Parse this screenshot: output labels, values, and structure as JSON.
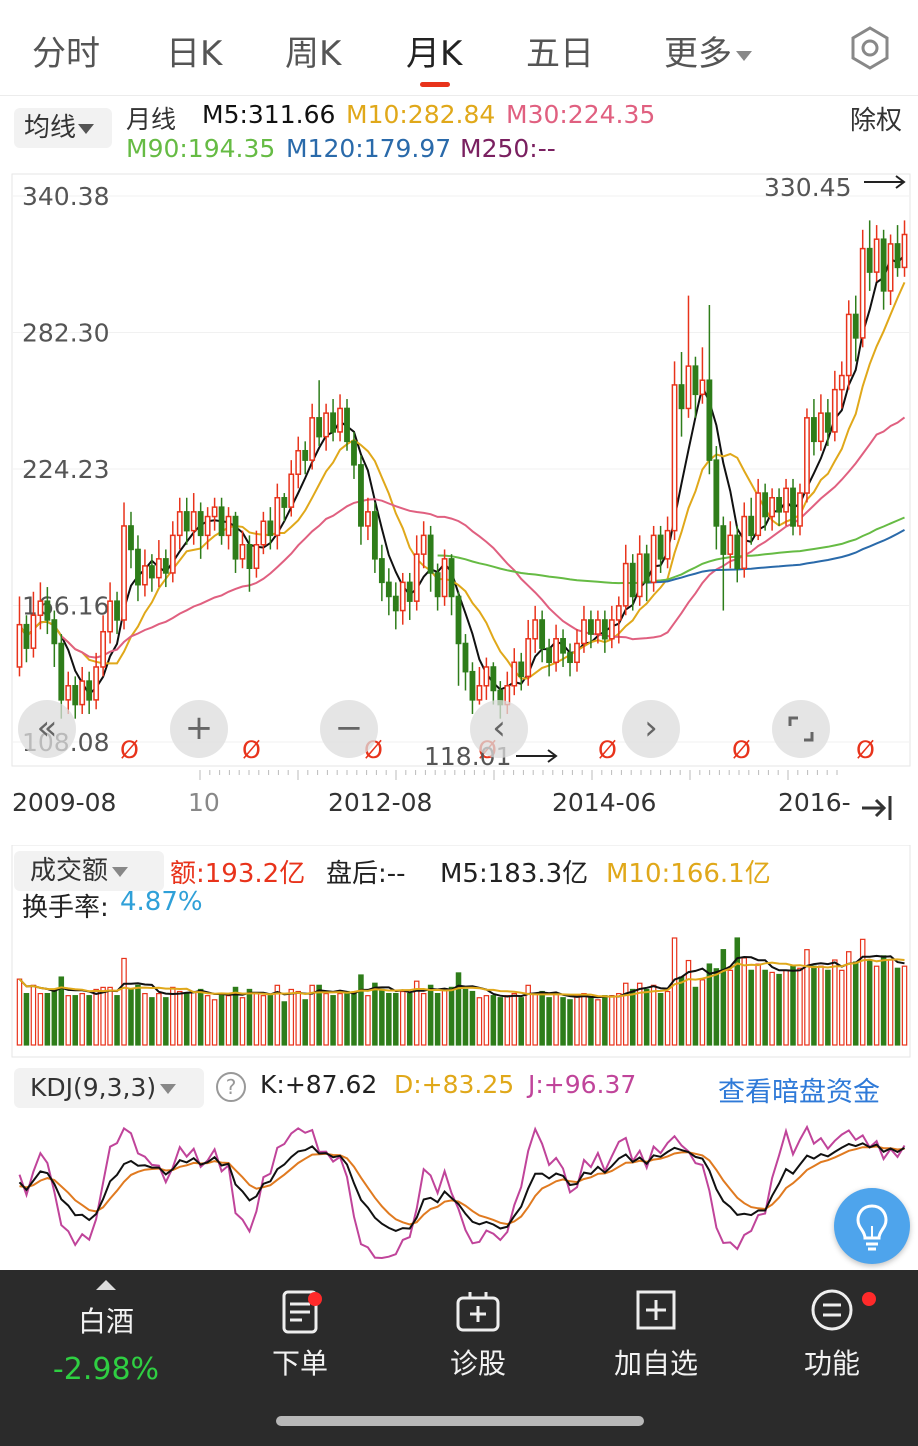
{
  "tabs": [
    {
      "label": "分时"
    },
    {
      "label": "日K"
    },
    {
      "label": "周K"
    },
    {
      "label": "月K"
    },
    {
      "label": "五日"
    },
    {
      "label": "更多"
    }
  ],
  "active_tab": "月K",
  "ma_bar": {
    "select_label": "均线",
    "period_label": "月线",
    "m5": "M5:311.66",
    "m10": "M10:282.84",
    "m30": "M30:224.35",
    "m90": "M90:194.35",
    "m120": "M120:179.97",
    "m250": "M250:--",
    "adjust_label": "除权"
  },
  "colors": {
    "up": "#e8331b",
    "down": "#2e7d1a",
    "m5": "#111111",
    "m10": "#e0a81a",
    "m30": "#e06080",
    "m90": "#66bb44",
    "m120": "#2a6aaa",
    "m250": "#7a2060",
    "accent_link": "#2f7ad8"
  },
  "main_chart": {
    "price_levels": [
      "340.38",
      "282.30",
      "224.23",
      "166.16",
      "108.08"
    ],
    "high_marker": "330.45",
    "low_marker": "118.01",
    "dividend_mark": "Ø",
    "dates": [
      "2009-08",
      "10",
      "2012-08",
      "2014-06",
      "2016-"
    ],
    "controls": {
      "zoom_in": "+",
      "zoom_out": "−",
      "prev": "‹",
      "next": "›",
      "rewind": "«"
    }
  },
  "chart_data": {
    "type": "candlestick",
    "ylim": [
      108.08,
      340.38
    ],
    "y_ticks": [
      340.38,
      282.3,
      224.23,
      166.16,
      108.08
    ],
    "x_tick_labels": [
      "2009-08",
      "10",
      "2012-08",
      "2014-06",
      "2016-"
    ],
    "series": [
      {
        "name": "月K",
        "values": [
          {
            "o": 140,
            "c": 158,
            "h": 170,
            "l": 136
          },
          {
            "o": 158,
            "c": 148,
            "h": 162,
            "l": 142
          },
          {
            "o": 148,
            "c": 162,
            "h": 172,
            "l": 144
          },
          {
            "o": 162,
            "c": 168,
            "h": 176,
            "l": 156
          },
          {
            "o": 168,
            "c": 160,
            "h": 174,
            "l": 154
          },
          {
            "o": 160,
            "c": 150,
            "h": 164,
            "l": 140
          },
          {
            "o": 150,
            "c": 126,
            "h": 154,
            "l": 118
          },
          {
            "o": 126,
            "c": 132,
            "h": 138,
            "l": 120
          },
          {
            "o": 132,
            "c": 124,
            "h": 136,
            "l": 118
          },
          {
            "o": 124,
            "c": 134,
            "h": 140,
            "l": 120
          },
          {
            "o": 134,
            "c": 126,
            "h": 138,
            "l": 120
          },
          {
            "o": 126,
            "c": 140,
            "h": 146,
            "l": 122
          },
          {
            "o": 140,
            "c": 155,
            "h": 162,
            "l": 136
          },
          {
            "o": 155,
            "c": 168,
            "h": 176,
            "l": 150
          },
          {
            "o": 168,
            "c": 160,
            "h": 172,
            "l": 154
          },
          {
            "o": 160,
            "c": 200,
            "h": 210,
            "l": 156
          },
          {
            "o": 200,
            "c": 190,
            "h": 206,
            "l": 182
          },
          {
            "o": 190,
            "c": 175,
            "h": 196,
            "l": 168
          },
          {
            "o": 175,
            "c": 183,
            "h": 190,
            "l": 170
          },
          {
            "o": 183,
            "c": 178,
            "h": 188,
            "l": 172
          },
          {
            "o": 178,
            "c": 186,
            "h": 194,
            "l": 174
          },
          {
            "o": 186,
            "c": 180,
            "h": 190,
            "l": 174
          },
          {
            "o": 180,
            "c": 196,
            "h": 202,
            "l": 176
          },
          {
            "o": 196,
            "c": 206,
            "h": 212,
            "l": 190
          },
          {
            "o": 206,
            "c": 198,
            "h": 212,
            "l": 192
          },
          {
            "o": 198,
            "c": 206,
            "h": 214,
            "l": 192
          },
          {
            "o": 206,
            "c": 196,
            "h": 210,
            "l": 186
          },
          {
            "o": 196,
            "c": 204,
            "h": 208,
            "l": 190
          },
          {
            "o": 204,
            "c": 208,
            "h": 212,
            "l": 198
          },
          {
            "o": 208,
            "c": 196,
            "h": 212,
            "l": 192
          },
          {
            "o": 196,
            "c": 204,
            "h": 208,
            "l": 190
          },
          {
            "o": 204,
            "c": 186,
            "h": 206,
            "l": 180
          },
          {
            "o": 186,
            "c": 192,
            "h": 198,
            "l": 182
          },
          {
            "o": 192,
            "c": 182,
            "h": 196,
            "l": 172
          },
          {
            "o": 182,
            "c": 192,
            "h": 198,
            "l": 178
          },
          {
            "o": 192,
            "c": 202,
            "h": 206,
            "l": 188
          },
          {
            "o": 202,
            "c": 196,
            "h": 208,
            "l": 190
          },
          {
            "o": 196,
            "c": 212,
            "h": 218,
            "l": 190
          },
          {
            "o": 212,
            "c": 208,
            "h": 214,
            "l": 202
          },
          {
            "o": 208,
            "c": 222,
            "h": 228,
            "l": 204
          },
          {
            "o": 222,
            "c": 232,
            "h": 238,
            "l": 216
          },
          {
            "o": 232,
            "c": 228,
            "h": 236,
            "l": 222
          },
          {
            "o": 228,
            "c": 246,
            "h": 252,
            "l": 224
          },
          {
            "o": 246,
            "c": 238,
            "h": 262,
            "l": 234
          },
          {
            "o": 238,
            "c": 248,
            "h": 252,
            "l": 232
          },
          {
            "o": 248,
            "c": 240,
            "h": 254,
            "l": 236
          },
          {
            "o": 240,
            "c": 250,
            "h": 256,
            "l": 236
          },
          {
            "o": 250,
            "c": 236,
            "h": 254,
            "l": 232
          },
          {
            "o": 236,
            "c": 226,
            "h": 240,
            "l": 220
          },
          {
            "o": 226,
            "c": 200,
            "h": 230,
            "l": 192
          },
          {
            "o": 200,
            "c": 206,
            "h": 212,
            "l": 194
          },
          {
            "o": 206,
            "c": 186,
            "h": 210,
            "l": 180
          },
          {
            "o": 186,
            "c": 176,
            "h": 192,
            "l": 168
          },
          {
            "o": 176,
            "c": 170,
            "h": 182,
            "l": 162
          },
          {
            "o": 170,
            "c": 164,
            "h": 176,
            "l": 156
          },
          {
            "o": 164,
            "c": 176,
            "h": 180,
            "l": 158
          },
          {
            "o": 176,
            "c": 168,
            "h": 180,
            "l": 160
          },
          {
            "o": 168,
            "c": 188,
            "h": 196,
            "l": 164
          },
          {
            "o": 188,
            "c": 196,
            "h": 202,
            "l": 182
          },
          {
            "o": 196,
            "c": 180,
            "h": 200,
            "l": 172
          },
          {
            "o": 180,
            "c": 170,
            "h": 184,
            "l": 164
          },
          {
            "o": 170,
            "c": 186,
            "h": 190,
            "l": 166
          },
          {
            "o": 186,
            "c": 170,
            "h": 188,
            "l": 162
          },
          {
            "o": 170,
            "c": 150,
            "h": 172,
            "l": 132
          },
          {
            "o": 150,
            "c": 138,
            "h": 154,
            "l": 130
          },
          {
            "o": 138,
            "c": 126,
            "h": 142,
            "l": 120
          },
          {
            "o": 126,
            "c": 132,
            "h": 140,
            "l": 124
          },
          {
            "o": 132,
            "c": 140,
            "h": 144,
            "l": 126
          },
          {
            "o": 140,
            "c": 130,
            "h": 142,
            "l": 124
          },
          {
            "o": 130,
            "c": 124,
            "h": 134,
            "l": 118
          },
          {
            "o": 124,
            "c": 132,
            "h": 138,
            "l": 120
          },
          {
            "o": 132,
            "c": 142,
            "h": 148,
            "l": 128
          },
          {
            "o": 142,
            "c": 136,
            "h": 146,
            "l": 130
          },
          {
            "o": 136,
            "c": 152,
            "h": 160,
            "l": 132
          },
          {
            "o": 152,
            "c": 160,
            "h": 166,
            "l": 146
          },
          {
            "o": 160,
            "c": 148,
            "h": 164,
            "l": 142
          },
          {
            "o": 148,
            "c": 142,
            "h": 152,
            "l": 136
          },
          {
            "o": 142,
            "c": 152,
            "h": 158,
            "l": 138
          },
          {
            "o": 152,
            "c": 146,
            "h": 156,
            "l": 140
          },
          {
            "o": 146,
            "c": 142,
            "h": 150,
            "l": 136
          },
          {
            "o": 142,
            "c": 150,
            "h": 156,
            "l": 138
          },
          {
            "o": 150,
            "c": 160,
            "h": 166,
            "l": 146
          },
          {
            "o": 160,
            "c": 154,
            "h": 164,
            "l": 148
          },
          {
            "o": 154,
            "c": 160,
            "h": 164,
            "l": 150
          },
          {
            "o": 160,
            "c": 152,
            "h": 164,
            "l": 146
          },
          {
            "o": 152,
            "c": 160,
            "h": 166,
            "l": 148
          },
          {
            "o": 160,
            "c": 166,
            "h": 170,
            "l": 150
          },
          {
            "o": 166,
            "c": 184,
            "h": 192,
            "l": 162
          },
          {
            "o": 184,
            "c": 170,
            "h": 188,
            "l": 164
          },
          {
            "o": 170,
            "c": 188,
            "h": 196,
            "l": 166
          },
          {
            "o": 188,
            "c": 176,
            "h": 192,
            "l": 168
          },
          {
            "o": 176,
            "c": 196,
            "h": 200,
            "l": 172
          },
          {
            "o": 196,
            "c": 186,
            "h": 200,
            "l": 180
          },
          {
            "o": 186,
            "c": 198,
            "h": 204,
            "l": 182
          },
          {
            "o": 198,
            "c": 260,
            "h": 270,
            "l": 194
          },
          {
            "o": 260,
            "c": 250,
            "h": 274,
            "l": 238
          },
          {
            "o": 250,
            "c": 268,
            "h": 298,
            "l": 246
          },
          {
            "o": 268,
            "c": 256,
            "h": 272,
            "l": 246
          },
          {
            "o": 256,
            "c": 262,
            "h": 276,
            "l": 252
          },
          {
            "o": 262,
            "c": 228,
            "h": 294,
            "l": 222
          },
          {
            "o": 228,
            "c": 200,
            "h": 234,
            "l": 190
          },
          {
            "o": 200,
            "c": 188,
            "h": 204,
            "l": 164
          },
          {
            "o": 188,
            "c": 196,
            "h": 202,
            "l": 182
          },
          {
            "o": 196,
            "c": 182,
            "h": 200,
            "l": 176
          },
          {
            "o": 182,
            "c": 204,
            "h": 210,
            "l": 178
          },
          {
            "o": 204,
            "c": 196,
            "h": 212,
            "l": 192
          },
          {
            "o": 196,
            "c": 214,
            "h": 220,
            "l": 194
          },
          {
            "o": 214,
            "c": 204,
            "h": 218,
            "l": 198
          },
          {
            "o": 204,
            "c": 212,
            "h": 216,
            "l": 198
          },
          {
            "o": 212,
            "c": 206,
            "h": 216,
            "l": 200
          },
          {
            "o": 206,
            "c": 216,
            "h": 220,
            "l": 200
          },
          {
            "o": 216,
            "c": 200,
            "h": 220,
            "l": 196
          },
          {
            "o": 200,
            "c": 214,
            "h": 218,
            "l": 196
          },
          {
            "o": 214,
            "c": 246,
            "h": 250,
            "l": 210
          },
          {
            "o": 246,
            "c": 236,
            "h": 254,
            "l": 230
          },
          {
            "o": 236,
            "c": 248,
            "h": 256,
            "l": 232
          },
          {
            "o": 248,
            "c": 240,
            "h": 254,
            "l": 234
          },
          {
            "o": 240,
            "c": 258,
            "h": 266,
            "l": 236
          },
          {
            "o": 258,
            "c": 264,
            "h": 270,
            "l": 250
          },
          {
            "o": 264,
            "c": 290,
            "h": 296,
            "l": 258
          },
          {
            "o": 290,
            "c": 280,
            "h": 298,
            "l": 270
          },
          {
            "o": 280,
            "c": 318,
            "h": 326,
            "l": 276
          },
          {
            "o": 318,
            "c": 308,
            "h": 330,
            "l": 300
          },
          {
            "o": 308,
            "c": 322,
            "h": 328,
            "l": 304
          },
          {
            "o": 322,
            "c": 300,
            "h": 326,
            "l": 292
          },
          {
            "o": 300,
            "c": 320,
            "h": 324,
            "l": 294
          },
          {
            "o": 320,
            "c": 310,
            "h": 328,
            "l": 306
          },
          {
            "o": 310,
            "c": 324,
            "h": 330,
            "l": 306
          }
        ]
      },
      {
        "name": "M5"
      },
      {
        "name": "M10"
      },
      {
        "name": "M30"
      },
      {
        "name": "M90"
      },
      {
        "name": "M120"
      }
    ]
  },
  "volume_panel": {
    "select_label": "成交额",
    "amount": "额:193.2亿",
    "after_hours": "盘后:--",
    "m5": "M5:183.3亿",
    "m10": "M10:166.1亿",
    "turnover_label": "换手率:",
    "turnover_value": "4.87%"
  },
  "kdj_panel": {
    "select_label": "KDJ(9,3,3)",
    "help": "?",
    "k": "K:+87.62",
    "d": "D:+83.25",
    "j": "J:+96.37",
    "link": "查看暗盘资金"
  },
  "bottom_bar": {
    "stock_name": "白酒",
    "stock_change": "-2.98%",
    "items": [
      {
        "label": "下单",
        "icon": "order-icon"
      },
      {
        "label": "诊股",
        "icon": "diagnose-icon"
      },
      {
        "label": "加自选",
        "icon": "add-watchlist-icon"
      },
      {
        "label": "功能",
        "icon": "menu-icon"
      }
    ]
  }
}
